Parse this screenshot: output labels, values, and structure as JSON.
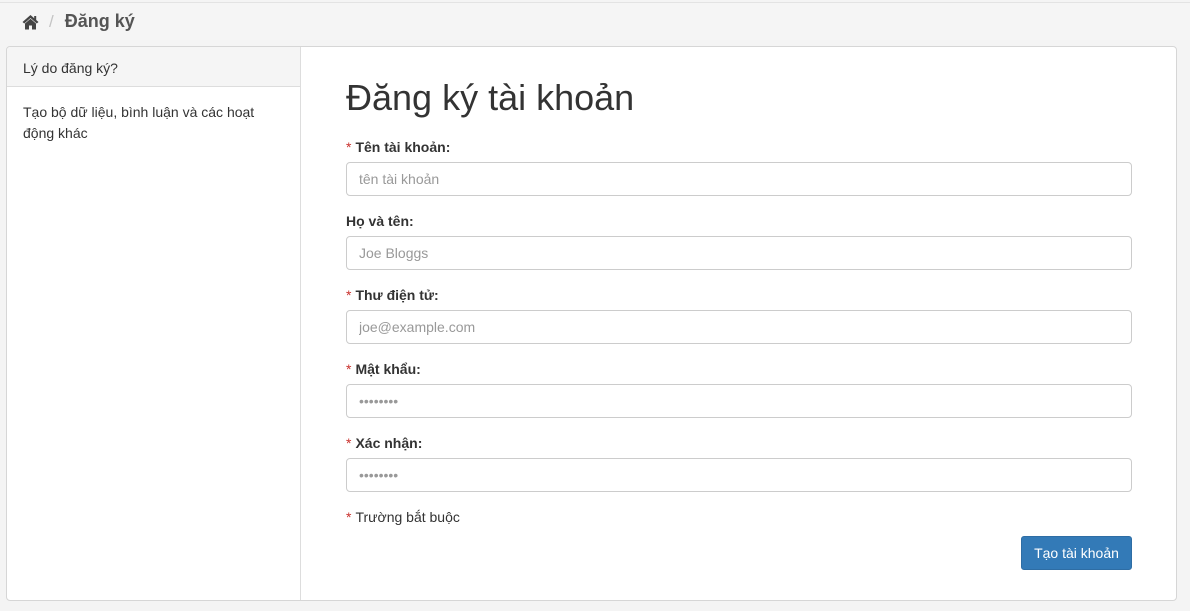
{
  "breadcrumb": {
    "home_icon": "home-icon",
    "separator": "/",
    "current": "Đăng ký"
  },
  "sidebar": {
    "header": "Lý do đăng ký?",
    "body": "Tạo bộ dữ liệu, bình luận và các hoạt động khác"
  },
  "form": {
    "title": "Đăng ký tài khoản",
    "required_marker": "*",
    "fields": {
      "username": {
        "label": "Tên tài khoản:",
        "placeholder": "tên tài khoản",
        "value": ""
      },
      "fullname": {
        "label": "Họ và tên:",
        "placeholder": "Joe Bloggs",
        "value": ""
      },
      "email": {
        "label": "Thư điện tử:",
        "placeholder": "joe@example.com",
        "value": ""
      },
      "password": {
        "label": "Mật khẩu:",
        "placeholder": "••••••••",
        "value": ""
      },
      "confirm": {
        "label": "Xác nhận:",
        "placeholder": "••••••••",
        "value": ""
      }
    },
    "required_note": "Trường bắt buộc",
    "submit_label": "Tạo tài khoản"
  },
  "colors": {
    "primary": "#337ab7",
    "required": "#c9302c"
  }
}
